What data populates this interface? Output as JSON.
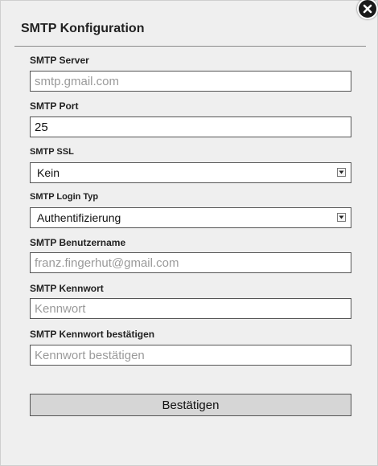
{
  "dialog": {
    "title": "SMTP Konfiguration"
  },
  "fields": {
    "server": {
      "label": "SMTP Server",
      "value": "",
      "placeholder": "smtp.gmail.com"
    },
    "port": {
      "label": "SMTP Port",
      "value": "25",
      "placeholder": ""
    },
    "ssl": {
      "label": "SMTP SSL",
      "selected": "Kein"
    },
    "login_type": {
      "label": "SMTP Login Typ",
      "selected": "Authentifizierung"
    },
    "username": {
      "label": "SMTP Benutzername",
      "value": "",
      "placeholder": "franz.fingerhut@gmail.com"
    },
    "password": {
      "label": "SMTP Kennwort",
      "value": "",
      "placeholder": "Kennwort"
    },
    "password_confirm": {
      "label": "SMTP Kennwort bestätigen",
      "value": "",
      "placeholder": "Kennwort bestätigen"
    }
  },
  "actions": {
    "confirm_label": "Bestätigen"
  },
  "icons": {
    "close": "close-icon",
    "dropdown": "chevron-down-icon"
  }
}
